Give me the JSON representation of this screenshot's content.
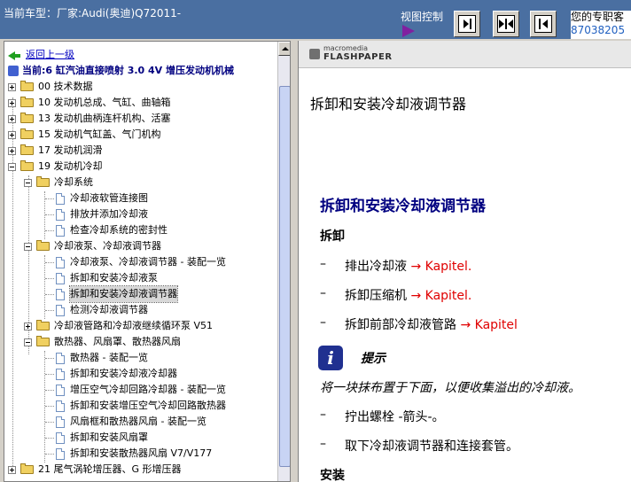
{
  "header": {
    "car_label": "当前车型：厂家:Audi(奥迪)Q72011-",
    "view_control": "视图控制",
    "expert_line1": "您的专职客",
    "expert_line2": "87038205"
  },
  "tree": {
    "back": "返回上一级",
    "current": "当前:6 缸汽油直接喷射  3.0 4V 增压发动机机械",
    "items": [
      {
        "label": "00 技术数据"
      },
      {
        "label": "10 发动机总成、气缸、曲轴箱"
      },
      {
        "label": "13 发动机曲柄连杆机构、活塞"
      },
      {
        "label": "15 发动机气缸盖、气门机构"
      },
      {
        "label": "17 发动机润滑"
      },
      {
        "label": "19 发动机冷却"
      },
      {
        "label": "冷却系统"
      },
      {
        "label": "冷却液软管连接图"
      },
      {
        "label": "排放并添加冷却液"
      },
      {
        "label": "检查冷却系统的密封性"
      },
      {
        "label": "冷却液泵、冷却液调节器"
      },
      {
        "label": "冷却液泵、冷却液调节器 - 装配一览"
      },
      {
        "label": "拆卸和安装冷却液泵"
      },
      {
        "label": "拆卸和安装冷却液调节器"
      },
      {
        "label": "检测冷却液调节器"
      },
      {
        "label": "冷却液管路和冷却液继续循环泵 V51"
      },
      {
        "label": "散热器、风扇罩、散热器风扇"
      },
      {
        "label": "散热器 - 装配一览"
      },
      {
        "label": "拆卸和安装冷却液冷却器"
      },
      {
        "label": "增压空气冷却回路冷却器 - 装配一览"
      },
      {
        "label": "拆卸和安装增压空气冷却回路散热器"
      },
      {
        "label": "风扇框和散热器风扇 - 装配一览"
      },
      {
        "label": "拆卸和安装风扇罩"
      },
      {
        "label": "拆卸和安装散热器风扇  V7/V177"
      },
      {
        "label": "21 尾气涡轮增压器、G 形增压器"
      }
    ]
  },
  "viewer": {
    "brand_small": "macromedia",
    "brand_big": "FLASHPAPER",
    "top_title": "拆卸和安装冷却液调节器",
    "doc_title": "拆卸和安装冷却液调节器",
    "removal_heading": "拆卸",
    "dash": "–",
    "steps": [
      {
        "text": "排出冷却液 ",
        "link": "→ Kapitel."
      },
      {
        "text": "拆卸压缩机 ",
        "link": "→ Kapitel."
      },
      {
        "text": "拆卸前部冷却液管路 ",
        "link": "→ Kapitel"
      }
    ],
    "hint_icon": "i",
    "hint_label": "提示",
    "hint_text": "将一块抹布置于下面，以便收集溢出的冷却液。",
    "steps2": [
      {
        "text": "拧出螺栓 -箭头-。"
      },
      {
        "text": "取下冷却液调节器和连接套管。"
      }
    ],
    "install_heading": "安装"
  }
}
